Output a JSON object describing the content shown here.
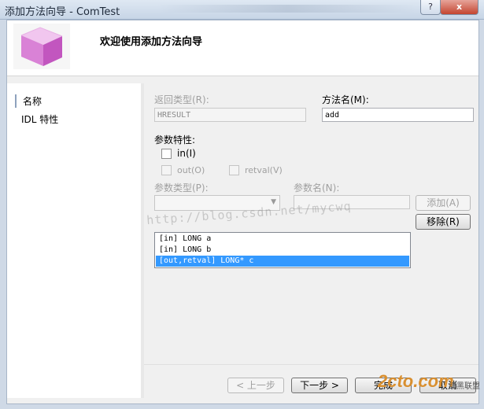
{
  "window": {
    "title": "添加方法向导 - ComTest"
  },
  "controls": {
    "help": "?",
    "close": "x"
  },
  "header": {
    "title": "欢迎使用添加方法向导",
    "icon": "purple-cube-icon"
  },
  "nav": {
    "items": [
      "名称",
      "IDL 特性"
    ]
  },
  "form": {
    "return_type_label": "返回类型(R):",
    "return_type_value": "HRESULT",
    "method_name_label": "方法名(M):",
    "method_name_value": "add",
    "params_attr_label": "参数特性:",
    "in_label": "in(I)",
    "out_label": "out(O)",
    "retval_label": "retval(V)",
    "param_type_label": "参数类型(P):",
    "param_name_label": "参数名(N):",
    "add_button": "添加(A)",
    "remove_button": "移除(R)",
    "param_list": [
      "[in] LONG a",
      "[in] LONG b",
      "[out,retval] LONG* c"
    ]
  },
  "footer": {
    "prev": "< 上一步",
    "next": "下一步 >",
    "finish": "完成",
    "cancel": "取消"
  },
  "watermark": "http://blog.csdn.net/mycwq",
  "logo": {
    "main": "2cto.com",
    "sub": "红黑联盟"
  }
}
